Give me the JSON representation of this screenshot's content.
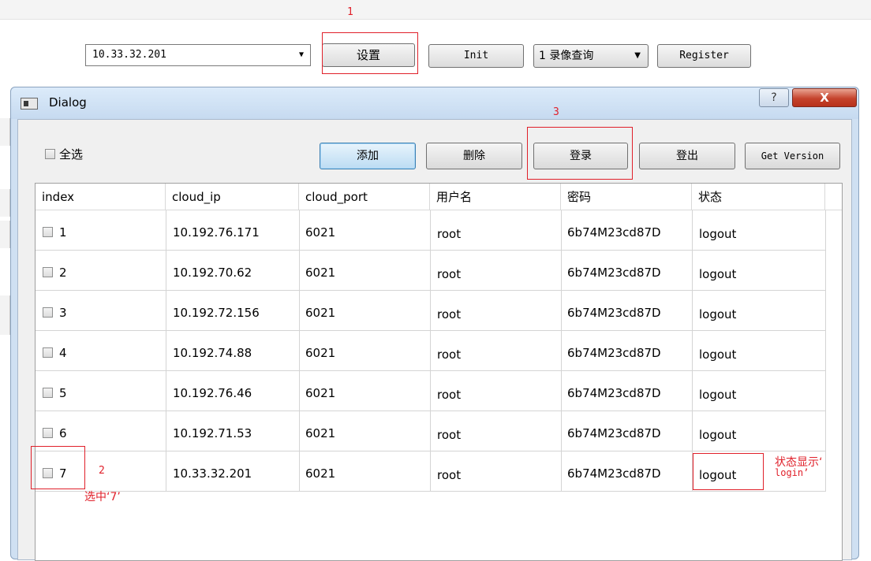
{
  "toolbar": {
    "ip_select": "10.33.32.201",
    "settings_button": "设置",
    "init_button": "Init",
    "query_select": "1 录像查询",
    "register_button": "Register"
  },
  "annotations": {
    "step1": "1",
    "step2": "2",
    "step3": "3",
    "select7": "选中‘7’",
    "status_line1": "状态显示‘",
    "status_line2": "login’"
  },
  "dialog": {
    "title": "Dialog",
    "help": "?",
    "close": "X",
    "select_all": "全选",
    "add_button": "添加",
    "delete_button": "删除",
    "login_button": "登录",
    "logout_button": "登出",
    "version_button": "Get Version"
  },
  "table": {
    "columns": [
      "index",
      "cloud_ip",
      "cloud_port",
      "用户名",
      "密码",
      "状态"
    ],
    "rows": [
      [
        "1",
        "10.192.76.171",
        "6021",
        "root",
        "6b74M23cd87D",
        "logout"
      ],
      [
        "2",
        "10.192.70.62",
        "6021",
        "root",
        "6b74M23cd87D",
        "logout"
      ],
      [
        "3",
        "10.192.72.156",
        "6021",
        "root",
        "6b74M23cd87D",
        "logout"
      ],
      [
        "4",
        "10.192.74.88",
        "6021",
        "root",
        "6b74M23cd87D",
        "logout"
      ],
      [
        "5",
        "10.192.76.46",
        "6021",
        "root",
        "6b74M23cd87D",
        "logout"
      ],
      [
        "6",
        "10.192.71.53",
        "6021",
        "root",
        "6b74M23cd87D",
        "logout"
      ],
      [
        "7",
        "10.33.32.201",
        "6021",
        "root",
        "6b74M23cd87D",
        "logout"
      ]
    ]
  },
  "colors": {
    "annotation": "#e0202a",
    "dialog_frame": "#cfe0f2",
    "close_button": "#c5432c"
  },
  "icons": {
    "dropdown": "chevron-down-icon",
    "dialog": "window-icon"
  }
}
